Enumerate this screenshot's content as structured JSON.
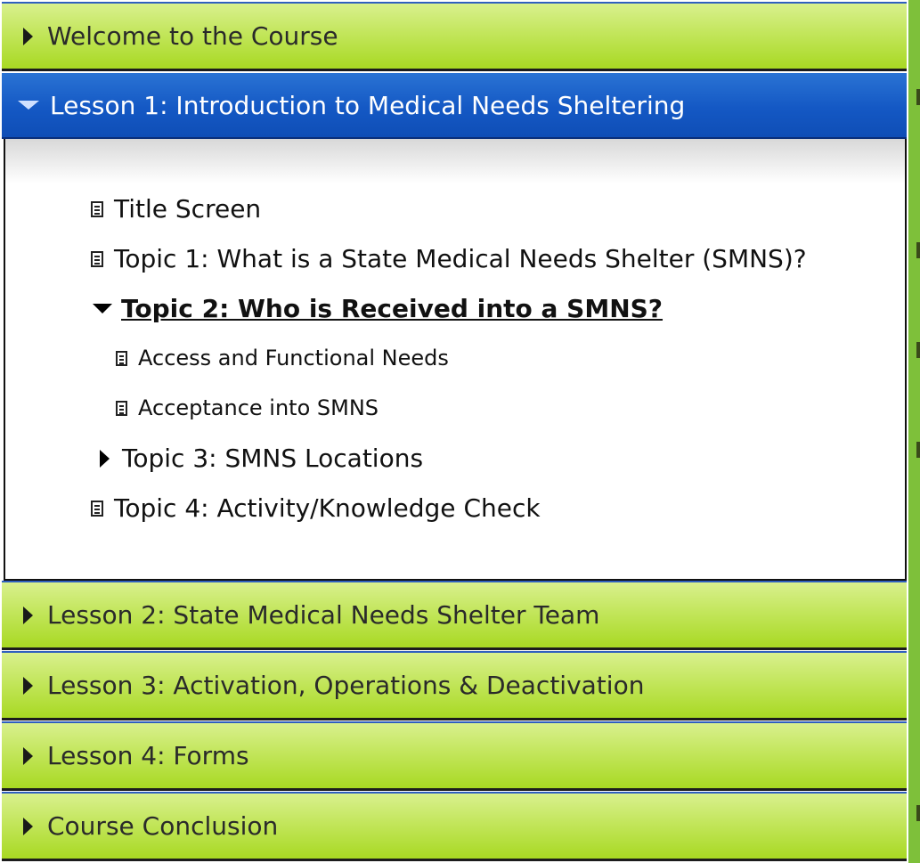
{
  "accordion": {
    "welcome": {
      "label": "Welcome to the Course",
      "expanded": false
    },
    "lesson1": {
      "label": "Lesson 1: Introduction to Medical Needs Sheltering",
      "expanded": true,
      "items": [
        {
          "label": "Title Screen",
          "icon": "page-icon"
        },
        {
          "label": "Topic 1: What is a State Medical Needs Shelter (SMNS)?",
          "icon": "page-icon"
        },
        {
          "label": "Topic 2: Who is Received into a SMNS?",
          "icon": "expanded-triangle-icon",
          "current": true,
          "children": [
            {
              "label": "Access and Functional Needs",
              "icon": "page-icon"
            },
            {
              "label": "Acceptance into SMNS",
              "icon": "page-icon"
            }
          ]
        },
        {
          "label": "Topic 3: SMNS Locations",
          "icon": "collapsed-triangle-icon"
        },
        {
          "label": "Topic 4: Activity/Knowledge Check",
          "icon": "page-icon"
        }
      ]
    },
    "lesson2": {
      "label": "Lesson 2: State Medical Needs Shelter Team",
      "expanded": false
    },
    "lesson3": {
      "label": "Lesson 3: Activation, Operations & Deactivation",
      "expanded": false
    },
    "lesson4": {
      "label": "Lesson 4: Forms",
      "expanded": false
    },
    "conclusion": {
      "label": "Course Conclusion",
      "expanded": false
    }
  },
  "colors": {
    "section_green": "#b8e040",
    "active_blue": "#1458c4",
    "side_strip": "#7ec03a"
  }
}
